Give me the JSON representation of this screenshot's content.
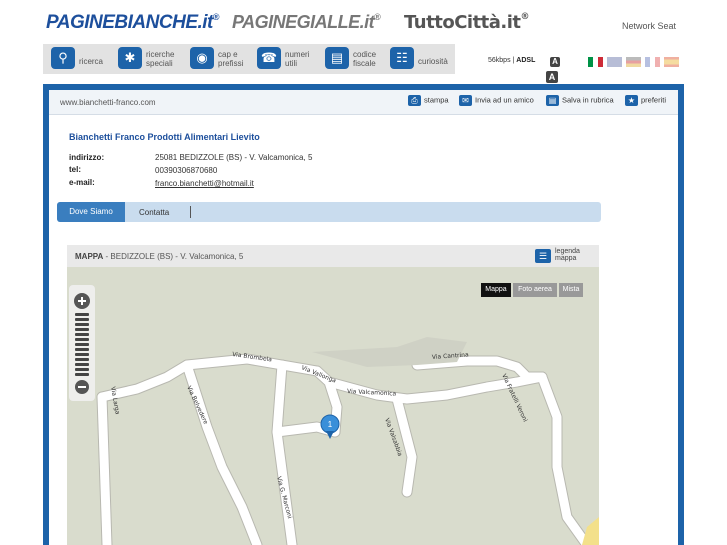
{
  "header": {
    "logo_paginebianche": "PAGINEBIANCHE.it",
    "logo_paginegialle": "PAGINEGIALLE.it",
    "logo_tuttocitta": "TuttoCittà.it",
    "network": "Network Seat"
  },
  "toolbar": {
    "items": [
      {
        "label": "ricerca",
        "icon": "search-icon"
      },
      {
        "label": "ricerche\nspeciali",
        "icon": "puzzle-icon"
      },
      {
        "label": "cap e\nprefissi",
        "icon": "globe-icon"
      },
      {
        "label": "numeri\nutili",
        "icon": "phone-icon"
      },
      {
        "label": "codice\nfiscale",
        "icon": "card-icon"
      },
      {
        "label": "curiosità",
        "icon": "book-icon"
      }
    ],
    "speed": "56kbps",
    "adsl": "ADSL",
    "font_small": "A",
    "font_large": "A"
  },
  "address_bar": {
    "url": "www.bianchetti-franco.com",
    "actions": [
      {
        "label": "stampa",
        "icon": "print-icon"
      },
      {
        "label": "Invia ad un amico",
        "icon": "mail-icon"
      },
      {
        "label": "Salva in rubrica",
        "icon": "folder-icon"
      },
      {
        "label": "preferiti",
        "icon": "star-icon"
      }
    ]
  },
  "business": {
    "name": "Bianchetti Franco Prodotti Alimentari Lievito",
    "address_label": "indirizzo:",
    "address": "25081 BEDIZZOLE (BS) - V. Valcamonica, 5",
    "tel_label": "tel:",
    "tel": "00390306870680",
    "email_label": "e-mail:",
    "email": "franco.bianchetti@hotmail.it"
  },
  "tabs": {
    "dove_siamo": "Dove Siamo",
    "contatta": "Contatta"
  },
  "map": {
    "title_bold": "MAPPA",
    "title_rest": " - BEDIZZOLE (BS) - V. Valcamonica, 5",
    "legend_label": "legenda\nmappa",
    "btn_mappa": "Mappa",
    "btn_foto": "Foto aerea",
    "btn_mista": "Mista",
    "marker": "1",
    "roads": [
      "Via Brombela",
      "Via Cantrina",
      "Via Vallonga",
      "Via Valcamonica",
      "Via Larga",
      "Via Belvedere",
      "Via Valsabbia",
      "Via Fratelli Veroni",
      "Via G. Marconi"
    ]
  },
  "colors": {
    "brand_blue": "#1d63a9",
    "map_bg": "#d9dccd"
  }
}
